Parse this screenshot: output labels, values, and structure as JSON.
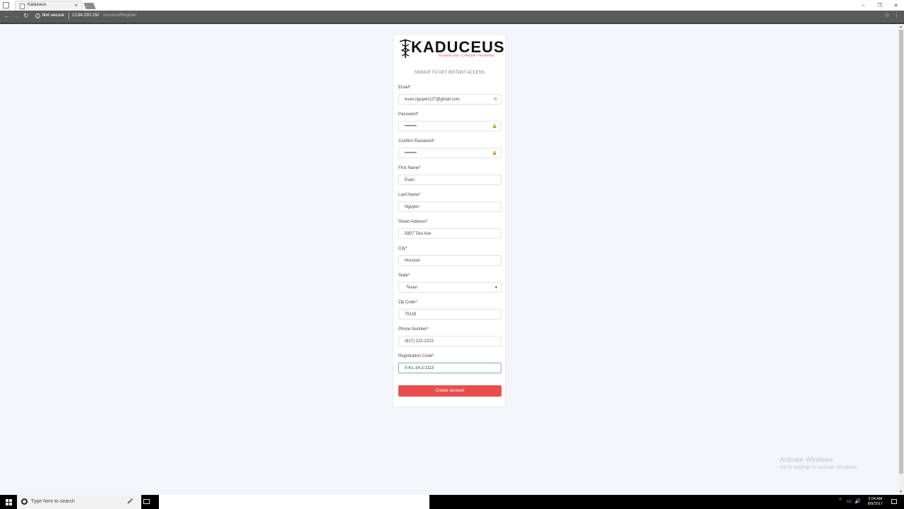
{
  "browser": {
    "tab_title": "Kaduceus",
    "tab_close": "×",
    "window_controls": [
      "–",
      "❐",
      "✕"
    ],
    "nav_back": "←",
    "nav_forward": "→",
    "nav_reload": "↻",
    "security_label": "Not secure",
    "url_host": "13.84.230.150",
    "url_path": "/Account/Register"
  },
  "logo": {
    "name": "KADUCEUS",
    "tagline": "\"HANDS-ON\" CAREER TRAINING"
  },
  "form": {
    "subtitle": "SIGNUP TO GET INSTANT ACCESS.",
    "email": {
      "label": "Email*",
      "value": "evan.nguyen127@gmail.com",
      "icon": "✉"
    },
    "password": {
      "label": "Password*",
      "value": "••••••••",
      "icon": "🔒"
    },
    "confirm_password": {
      "label": "Confirm Password*",
      "value": "••••••••",
      "icon": "🔒"
    },
    "first_name": {
      "label": "First Name*",
      "value": "Evan"
    },
    "last_name": {
      "label": "Last Name*",
      "value": "Nguyen"
    },
    "street_address": {
      "label": "Street Address*",
      "value": "5807 Test Ave"
    },
    "city": {
      "label": "City*",
      "value": "Houston"
    },
    "state": {
      "label": "State*",
      "value": "Texas",
      "arrow": "▼"
    },
    "zip": {
      "label": "Zip Code*",
      "value": "75118"
    },
    "phone": {
      "label": "Phone Number*",
      "value": "(817) 222-2222"
    },
    "registration_code": {
      "label": "Registration Code*",
      "value": "0-KL-14-2-1113"
    },
    "submit_label": "Create account"
  },
  "watermark": {
    "title": "Activate Windows",
    "subtitle": "Go to Settings to activate Windows."
  },
  "taskbar": {
    "search_placeholder": "Type here to search",
    "time": "2:04 AM",
    "date": "8/9/2017"
  }
}
